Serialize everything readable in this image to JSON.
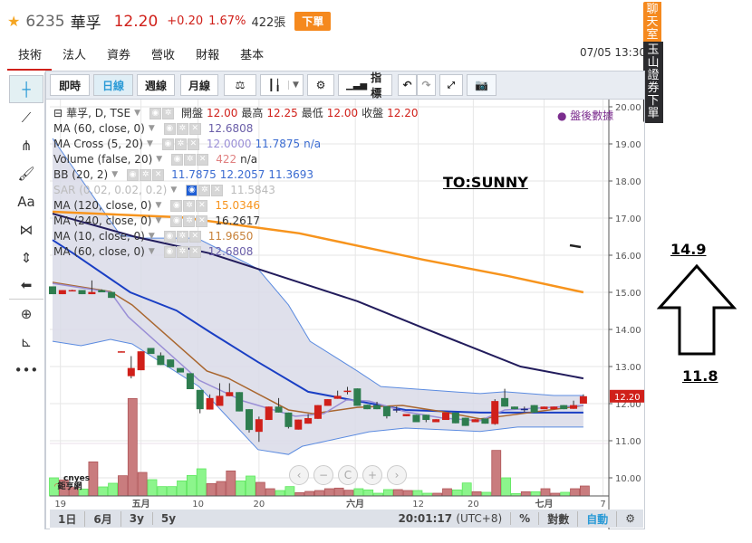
{
  "header": {
    "star_icon": "star-icon",
    "code": "6235",
    "name": "華孚",
    "price": "12.20",
    "change": "+0.20",
    "change_pct": "1.67%",
    "volume": "422張",
    "order_button": "下單"
  },
  "tabs": [
    {
      "label": "技術",
      "active": true
    },
    {
      "label": "法人"
    },
    {
      "label": "資券"
    },
    {
      "label": "營收"
    },
    {
      "label": "財報"
    },
    {
      "label": "基本"
    }
  ],
  "datetime": "07/05 13:30",
  "side_tags": {
    "chat": "聊天室",
    "broker_order": "玉山證券下單"
  },
  "toolbar": {
    "realtime": "即時",
    "daily": "日線",
    "weekly": "週線",
    "monthly": "月線",
    "compare_icon": "scale-icon",
    "chart_type_icon": "candlestick-icon",
    "settings_icon": "gear-icon",
    "indicators": "指標",
    "undo_icon": "undo-icon",
    "redo_icon": "redo-icon",
    "fullscreen_icon": "fullscreen-icon",
    "snapshot_icon": "camera-icon"
  },
  "drawing_tools": [
    "crosshair-icon",
    "trend-line-icon",
    "pitchfork-icon",
    "brush-icon",
    "text-icon",
    "pattern-icon",
    "measure-icon",
    "arrow-left-icon",
    "zoom-in-icon",
    "ruler-icon",
    "more-icon"
  ],
  "drawing_tool_text": "Aa",
  "legend": {
    "main": {
      "title": "華孚, D, TSE",
      "open_label": "開盤",
      "open": "12.00",
      "high_label": "最高",
      "high": "12.25",
      "low_label": "最低",
      "low": "12.00",
      "close_label": "收盤",
      "close": "12.20"
    },
    "studies": [
      {
        "name": "MA (60, close, 0)",
        "values": [
          "12.6808"
        ],
        "colors": [
          "#6a5ea8"
        ]
      },
      {
        "name": "MA Cross (5, 20)",
        "values": [
          "12.0000",
          "11.7875",
          "n/a"
        ],
        "colors": [
          "#9a8fd6",
          "#3a6bd1",
          "#3a6bd1"
        ]
      },
      {
        "name": "Volume (false, 20)",
        "values": [
          "422",
          "n/a"
        ],
        "colors": [
          "#e08080",
          "#333333"
        ]
      },
      {
        "name": "BB (20, 2)",
        "values": [
          "11.7875",
          "12.2057",
          "11.3693"
        ],
        "colors": [
          "#3a6bd1",
          "#3a6bd1",
          "#3a6bd1"
        ]
      },
      {
        "name": "SAR (0.02, 0.02, 0.2)",
        "values": [
          "11.5843"
        ],
        "colors": [
          "#bbbbbb"
        ],
        "hidden": true
      },
      {
        "name": "MA (120, close, 0)",
        "values": [
          "15.0346"
        ],
        "colors": [
          "#f7941d"
        ]
      },
      {
        "name": "MA (240, close, 0)",
        "values": [
          "16.2617"
        ],
        "colors": [
          "#333333"
        ]
      },
      {
        "name": "MA (10, close, 0)",
        "values": [
          "11.9650"
        ],
        "colors": [
          "#c8823a"
        ]
      },
      {
        "name": "MA (60, close, 0)",
        "values": [
          "12.6808"
        ],
        "colors": [
          "#6a5ea8"
        ]
      }
    ],
    "after_hours": "盤後數據"
  },
  "annotations": {
    "note": "TO:SUNNY",
    "upper_price": "14.9",
    "lower_price": "11.8",
    "arrow": "up-arrow"
  },
  "logo_text": [
    "cnyes",
    "鉅亨網"
  ],
  "nav_buttons": [
    "‹",
    "−",
    "C",
    "+",
    "›"
  ],
  "bottom": {
    "ranges": [
      "1日",
      "6月",
      "3y",
      "5y"
    ],
    "time": "20:01:17",
    "tz": "(UTC+8)",
    "percent": "%",
    "log": "對數",
    "auto": "自動",
    "settings_icon": "gear-icon"
  },
  "chart_data": {
    "type": "candlestick",
    "symbol": "華孚, D, TSE",
    "ylim": [
      10,
      20
    ],
    "y_ticks": [
      "20.00",
      "19.00",
      "18.00",
      "17.00",
      "16.00",
      "15.00",
      "14.00",
      "13.00",
      "12.00",
      "11.00",
      "10.00"
    ],
    "x_ticks": [
      "19",
      "五月",
      "10",
      "20",
      "六月",
      "12",
      "20",
      "七月",
      "7"
    ],
    "last_price": "12.20",
    "colors": {
      "up": "#d0201a",
      "down": "#2e7d4f",
      "vol_up": "#c97c7e",
      "vol_down": "#8cf58c",
      "ma120": "#f7941d",
      "ma60": "#221c5c",
      "ma20": "#1a3fc4",
      "ma10": "#a9662f",
      "ma5": "#9a8fd6",
      "bb": "#5b8be0",
      "bb_fill": "#d9dae8"
    },
    "ohlc": [
      [
        15.16,
        15.16,
        14.95,
        14.95
      ],
      [
        14.95,
        15.06,
        14.95,
        15.06
      ],
      [
        15.04,
        15.07,
        15.03,
        15.06
      ],
      [
        15.06,
        15.06,
        14.95,
        14.95
      ],
      [
        14.95,
        15.32,
        14.95,
        15.01
      ],
      [
        15.06,
        15.08,
        15.0,
        15.0
      ],
      [
        15.01,
        15.01,
        14.85,
        14.85
      ],
      [
        13.38,
        13.41,
        13.38,
        13.41
      ],
      [
        12.74,
        13.28,
        12.68,
        12.96
      ],
      [
        12.9,
        13.41,
        12.9,
        13.41
      ],
      [
        13.5,
        13.5,
        13.34,
        13.34
      ],
      [
        13.3,
        13.38,
        13.04,
        13.04
      ],
      [
        13.19,
        13.19,
        12.98,
        12.98
      ],
      [
        12.96,
        12.96,
        12.84,
        12.84
      ],
      [
        12.82,
        12.82,
        12.39,
        12.39
      ],
      [
        12.37,
        12.37,
        11.74,
        11.85
      ],
      [
        11.84,
        12.25,
        11.84,
        12.15
      ],
      [
        11.94,
        12.55,
        11.94,
        12.21
      ],
      [
        12.2,
        12.55,
        12.2,
        12.31
      ],
      [
        12.31,
        12.31,
        11.79,
        11.79
      ],
      [
        11.85,
        11.85,
        11.22,
        11.29
      ],
      [
        11.24,
        11.65,
        10.97,
        11.58
      ],
      [
        11.56,
        11.92,
        11.56,
        11.92
      ],
      [
        11.92,
        12.15,
        11.76,
        11.76
      ],
      [
        11.76,
        11.76,
        11.33,
        11.37
      ],
      [
        11.3,
        11.57,
        11.3,
        11.57
      ],
      [
        11.46,
        11.72,
        11.46,
        11.61
      ],
      [
        11.59,
        11.96,
        11.59,
        11.96
      ],
      [
        11.94,
        12.12,
        11.94,
        12.12
      ],
      [
        12.13,
        12.35,
        12.13,
        12.21
      ],
      [
        12.34,
        12.45,
        12.25,
        12.35
      ],
      [
        12.41,
        12.41,
        11.94,
        11.94
      ],
      [
        11.97,
        11.97,
        11.85,
        11.85
      ],
      [
        11.96,
        12.05,
        11.85,
        11.85
      ],
      [
        11.93,
        11.93,
        11.6,
        11.66
      ],
      [
        11.84,
        11.92,
        11.76,
        11.85
      ],
      [
        11.66,
        11.72,
        11.66,
        11.72
      ],
      [
        11.7,
        11.7,
        11.5,
        11.5
      ],
      [
        11.7,
        11.7,
        11.5,
        11.56
      ],
      [
        11.5,
        11.58,
        11.5,
        11.58
      ],
      [
        11.56,
        11.76,
        11.56,
        11.76
      ],
      [
        11.76,
        11.76,
        11.47,
        11.47
      ],
      [
        11.62,
        11.62,
        11.4,
        11.4
      ],
      [
        11.5,
        11.58,
        11.5,
        11.58
      ],
      [
        11.6,
        11.6,
        11.46,
        11.46
      ],
      [
        11.45,
        12.12,
        11.43,
        12.07
      ],
      [
        12.15,
        12.4,
        11.92,
        11.92
      ],
      [
        11.92,
        11.92,
        11.85,
        11.85
      ],
      [
        11.85,
        11.92,
        11.78,
        11.86
      ],
      [
        11.96,
        11.96,
        11.76,
        11.76
      ],
      [
        11.85,
        11.92,
        11.85,
        11.92
      ],
      [
        11.85,
        11.92,
        11.85,
        11.92
      ],
      [
        11.96,
        11.96,
        11.85,
        11.85
      ],
      [
        11.86,
        12.08,
        11.86,
        11.96
      ],
      [
        12.0,
        12.25,
        12.0,
        12.2
      ]
    ],
    "volume": [
      768,
      678,
      358,
      294,
      1446,
      384,
      538,
      858,
      4134,
      998,
      691,
      397,
      397,
      640,
      870,
      1152,
      525,
      614,
      1062,
      640,
      845,
      576,
      307,
      230,
      397,
      141,
      192,
      230,
      307,
      333,
      243,
      307,
      256,
      115,
      269,
      269,
      230,
      230,
      115,
      115,
      307,
      256,
      550,
      179,
      154,
      1933,
      768,
      102,
      179,
      179,
      307,
      115,
      154,
      307,
      422
    ],
    "lines": {
      "ma120": [
        [
          0,
          17.17
        ],
        [
          13.1,
          17.02
        ],
        [
          25.1,
          16.59
        ],
        [
          37.7,
          15.88
        ],
        [
          46.3,
          15.44
        ],
        [
          54,
          15.0
        ]
      ],
      "ma60": [
        [
          0,
          17.12
        ],
        [
          8.5,
          16.49
        ],
        [
          16,
          16.05
        ],
        [
          20.9,
          15.63
        ],
        [
          31,
          14.76
        ],
        [
          37.9,
          14.02
        ],
        [
          47.6,
          13.0
        ],
        [
          54,
          12.68
        ]
      ],
      "ma20": [
        [
          0,
          16.41
        ],
        [
          2.1,
          16.05
        ],
        [
          7.9,
          15.0
        ],
        [
          12.6,
          14.51
        ],
        [
          16,
          13.93
        ],
        [
          20.9,
          13.12
        ],
        [
          26,
          12.32
        ],
        [
          31,
          12.07
        ],
        [
          35.9,
          11.83
        ],
        [
          43.5,
          11.76
        ],
        [
          54,
          11.76
        ]
      ],
      "ma10": [
        [
          0,
          15.27
        ],
        [
          5.9,
          15.02
        ],
        [
          8.1,
          14.66
        ],
        [
          15.7,
          12.88
        ],
        [
          17.9,
          12.68
        ],
        [
          24,
          11.83
        ],
        [
          26.5,
          11.73
        ],
        [
          31,
          11.9
        ],
        [
          35.6,
          11.95
        ],
        [
          39.7,
          11.78
        ],
        [
          43.5,
          11.59
        ],
        [
          45.7,
          11.66
        ],
        [
          54,
          11.95
        ]
      ],
      "ma5": [
        [
          0,
          15.24
        ],
        [
          5.9,
          15.0
        ],
        [
          7.7,
          14.34
        ],
        [
          14.9,
          12.63
        ],
        [
          19.4,
          12.07
        ],
        [
          24.7,
          11.66
        ],
        [
          27.6,
          11.73
        ],
        [
          29.9,
          12.1
        ],
        [
          32.2,
          12.07
        ],
        [
          35.9,
          11.78
        ],
        [
          39.7,
          11.61
        ],
        [
          43.5,
          11.54
        ],
        [
          46,
          11.83
        ],
        [
          54,
          11.95
        ]
      ],
      "bb_upper": [
        [
          0,
          19.15
        ],
        [
          6.9,
          16.54
        ],
        [
          9.1,
          16.46
        ],
        [
          14.7,
          16.46
        ],
        [
          20.9,
          15.63
        ],
        [
          24,
          14.66
        ],
        [
          26.2,
          13.68
        ],
        [
          31,
          12.88
        ],
        [
          33.4,
          12.46
        ],
        [
          43.5,
          12.27
        ],
        [
          46,
          12.32
        ],
        [
          51,
          12.22
        ],
        [
          54,
          12.22
        ]
      ],
      "bb_lower": [
        [
          0,
          13.68
        ],
        [
          2.9,
          13.56
        ],
        [
          5.9,
          13.73
        ],
        [
          8.1,
          13.61
        ],
        [
          14.9,
          12.46
        ],
        [
          20.9,
          10.76
        ],
        [
          24,
          10.63
        ],
        [
          25.4,
          10.85
        ],
        [
          32.2,
          11.24
        ],
        [
          35.9,
          11.34
        ],
        [
          43.5,
          11.25
        ],
        [
          47.3,
          11.37
        ],
        [
          54,
          11.37
        ]
      ]
    }
  }
}
